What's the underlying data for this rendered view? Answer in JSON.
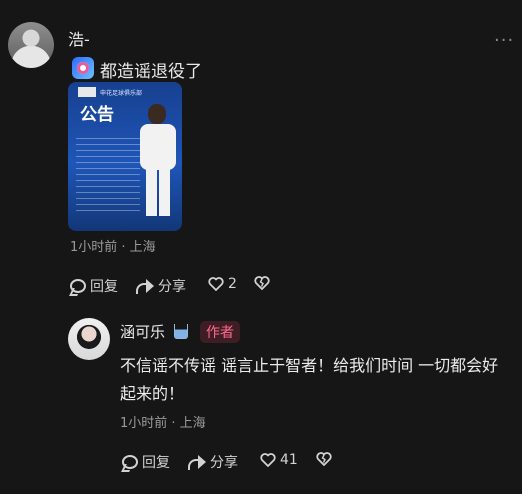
{
  "post": {
    "author": "浩-",
    "more_label": "···",
    "text": "都造谣退役了",
    "image": {
      "title": "公告",
      "subtitle": "申花足球俱乐部"
    },
    "meta": "1小时前 · 上海",
    "actions": {
      "reply_label": "回复",
      "share_label": "分享",
      "like_count": "2"
    }
  },
  "reply": {
    "author": "涵可乐",
    "badge": "作者",
    "text": "不信谣不传谣 谣言止于智者！给我们时间 一切都会好起来的！",
    "meta": "1小时前 · 上海",
    "actions": {
      "reply_label": "回复",
      "share_label": "分享",
      "like_count": "41"
    }
  },
  "icons": {
    "comment": "comment-icon",
    "share": "share-icon",
    "like": "heart-icon",
    "dislike": "broken-heart-icon"
  }
}
